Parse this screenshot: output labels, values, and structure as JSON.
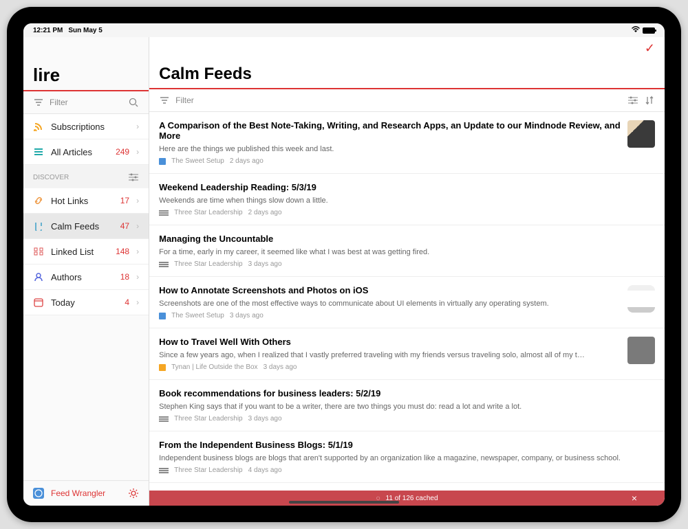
{
  "status": {
    "time": "12:21 PM",
    "date": "Sun May 5"
  },
  "sidebar": {
    "app_title": "lire",
    "filter_placeholder": "Filter",
    "subscriptions_label": "Subscriptions",
    "all_articles_label": "All Articles",
    "all_articles_count": "249",
    "discover_header": "DISCOVER",
    "items": [
      {
        "label": "Hot Links",
        "count": "17"
      },
      {
        "label": "Calm Feeds",
        "count": "47"
      },
      {
        "label": "Linked List",
        "count": "148"
      },
      {
        "label": "Authors",
        "count": "18"
      },
      {
        "label": "Today",
        "count": "4"
      }
    ],
    "footer_label": "Feed Wrangler"
  },
  "content": {
    "title": "Calm Feeds",
    "filter_placeholder": "Filter",
    "articles": [
      {
        "title": "A Comparison of the Best Note-Taking, Writing, and Research Apps, an Update to our Mindnode Review, and More",
        "excerpt": "Here are the things we published this week and last.",
        "source": "The Sweet Setup",
        "time": "2 days ago"
      },
      {
        "title": "Weekend Leadership Reading: 5/3/19",
        "excerpt": "Weekends are time when things slow down a little.",
        "source": "Three Star Leadership",
        "time": "2 days ago"
      },
      {
        "title": "Managing the Uncountable",
        "excerpt": "For a time, early in my career, it seemed like what I was best at was getting fired.",
        "source": "Three Star Leadership",
        "time": "3 days ago"
      },
      {
        "title": "How to Annotate Screenshots and Photos on iOS",
        "excerpt": "Screenshots are one of the most effective ways to communicate about UI elements in virtually any operating system.",
        "source": "The Sweet Setup",
        "time": "3 days ago"
      },
      {
        "title": "How to Travel Well With Others",
        "excerpt": "Since a few years ago, when I realized that I vastly preferred traveling with my friends versus traveling solo, almost all of my t…",
        "source": "Tynan | Life Outside the Box",
        "time": "3 days ago"
      },
      {
        "title": "Book recommendations for business leaders: 5/2/19",
        "excerpt": "Stephen King says that if you want to be a writer, there are two things you must do: read a lot and write a lot.",
        "source": "Three Star Leadership",
        "time": "3 days ago"
      },
      {
        "title": "From the Independent Business Blogs: 5/1/19",
        "excerpt": "Independent business blogs are blogs that aren't supported by an organization like a magazine, newspaper, company, or business school.",
        "source": "Three Star Leadership",
        "time": "4 days ago"
      }
    ]
  },
  "caching": {
    "text": "11 of 126 cached"
  }
}
